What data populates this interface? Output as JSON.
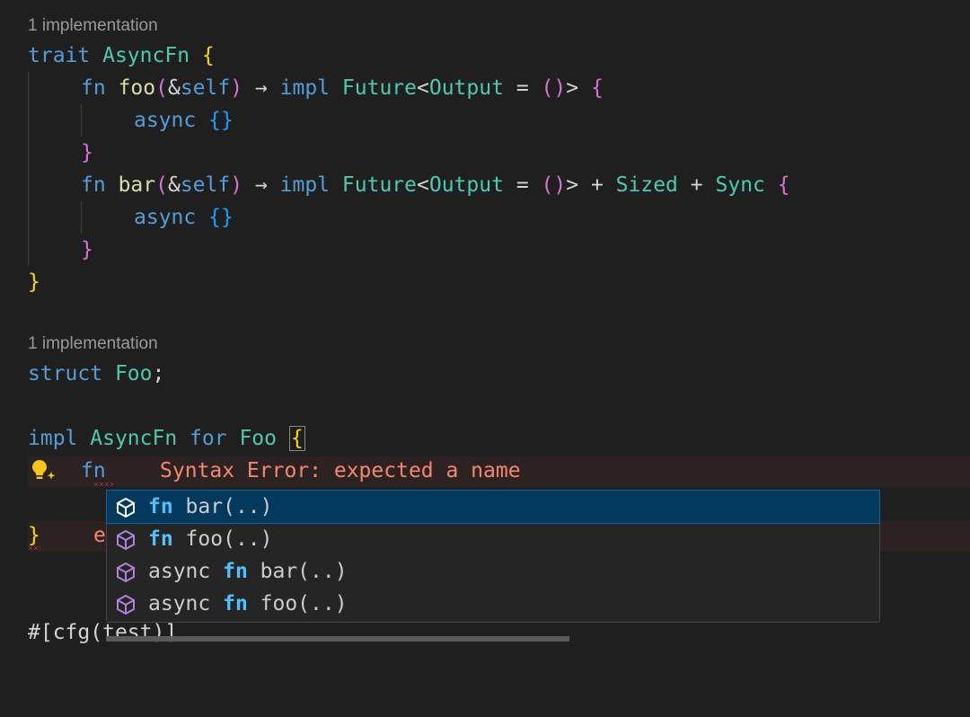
{
  "code_lens_1": "1 implementation",
  "line1": {
    "kw": "trait",
    "name": "AsyncFn",
    "brace": "{"
  },
  "line2": {
    "kw": "fn",
    "name": "foo",
    "open": "(",
    "amp": "&",
    "self": "self",
    "close": ")",
    "arrow": "→",
    "impl": "impl",
    "future": "Future",
    "lt": "<",
    "output": "Output",
    "eq": "=",
    "unit": "()",
    "gt": ">",
    "brace": "{"
  },
  "line3": {
    "kw": "async",
    "braces": "{}"
  },
  "line4": {
    "brace": "}"
  },
  "line5": {
    "kw": "fn",
    "name": "bar",
    "open": "(",
    "amp": "&",
    "self": "self",
    "close": ")",
    "arrow": "→",
    "impl": "impl",
    "future": "Future",
    "lt": "<",
    "output": "Output",
    "eq": "=",
    "unit": "()",
    "gt": ">",
    "plus1": "+",
    "sized": "Sized",
    "plus2": "+",
    "sync": "Sync",
    "brace": "{"
  },
  "line6": {
    "kw": "async",
    "braces": "{}"
  },
  "line7": {
    "brace": "}"
  },
  "line8": {
    "brace": "}"
  },
  "code_lens_2": "1 implementation",
  "line9": {
    "kw": "struct",
    "name": "Foo",
    "semi": ";"
  },
  "line10": {
    "impl": "impl",
    "trait": "AsyncFn",
    "for": "for",
    "type": "Foo",
    "brace": "{"
  },
  "line11": {
    "kw": "fn",
    "error": "Syntax Error: expected a name"
  },
  "line12": {
    "brace": "}",
    "partial": "e"
  },
  "line13": {
    "text_a": "#[cfg(",
    "text_b": "test",
    "text_c": ")]"
  },
  "suggestions": [
    {
      "prefix": "",
      "kw": "fn",
      "label": " bar(..)",
      "icon": "method-cube-icon"
    },
    {
      "prefix": "",
      "kw": "fn",
      "label": " foo(..)",
      "icon": "method-cube-icon"
    },
    {
      "prefix": "async ",
      "kw": "fn",
      "label": " bar(..)",
      "icon": "method-cube-icon"
    },
    {
      "prefix": "async ",
      "kw": "fn",
      "label": " foo(..)",
      "icon": "method-cube-icon"
    }
  ],
  "colors": {
    "background": "#1f1f1f",
    "selection": "#04395e",
    "error": "#f48771"
  }
}
